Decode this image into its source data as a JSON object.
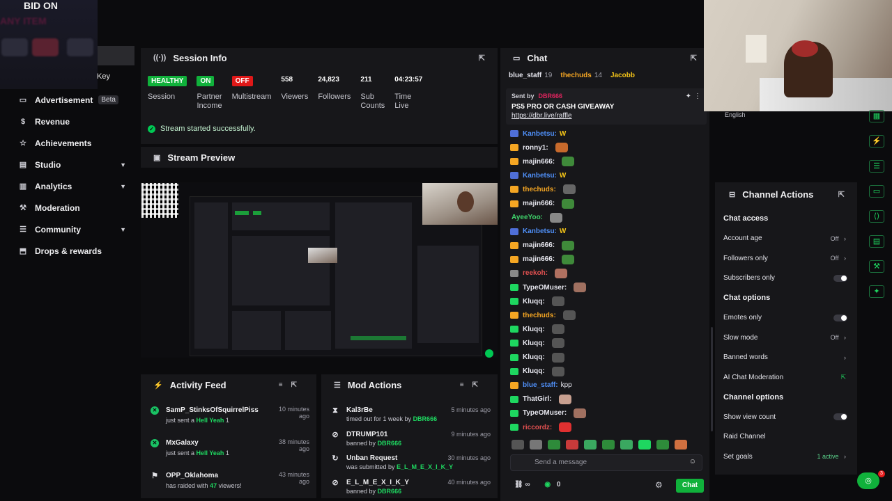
{
  "overlay": {
    "bid_on": "BID ON",
    "any_item": "ANY ITEM",
    "key_label": "Key"
  },
  "nav": {
    "items": [
      {
        "icon": "ad-icon",
        "glyph": "▭",
        "label": "Advertisement",
        "badge": "Beta",
        "chevron": false
      },
      {
        "icon": "revenue-icon",
        "glyph": "$",
        "label": "Revenue",
        "badge": "",
        "chevron": false
      },
      {
        "icon": "achievements-icon",
        "glyph": "☆",
        "label": "Achievements",
        "badge": "",
        "chevron": false
      },
      {
        "icon": "studio-icon",
        "glyph": "▤",
        "label": "Studio",
        "badge": "",
        "chevron": true
      },
      {
        "icon": "analytics-icon",
        "glyph": "▥",
        "label": "Analytics",
        "badge": "",
        "chevron": true
      },
      {
        "icon": "moderation-icon",
        "glyph": "⚒",
        "label": "Moderation",
        "badge": "",
        "chevron": false
      },
      {
        "icon": "community-icon",
        "glyph": "☰",
        "label": "Community",
        "badge": "",
        "chevron": true
      },
      {
        "icon": "drops-icon",
        "glyph": "⬒",
        "label": "Drops & rewards",
        "badge": "",
        "chevron": false
      }
    ]
  },
  "session": {
    "title": "Session Info",
    "stats": [
      {
        "value": "HEALTHY",
        "pill": "green",
        "label": "Session"
      },
      {
        "value": "ON",
        "pill": "green",
        "label": "Partner\nIncome"
      },
      {
        "value": "OFF",
        "pill": "red",
        "label": "Multistream"
      },
      {
        "value": "558",
        "pill": "",
        "label": "Viewers"
      },
      {
        "value": "24,823",
        "pill": "",
        "label": "Followers"
      },
      {
        "value": "211",
        "pill": "",
        "label": "Sub\nCounts"
      },
      {
        "value": "04:23:57",
        "pill": "",
        "label": "Time\nLive"
      }
    ],
    "status": "Stream started successfully."
  },
  "preview": {
    "title": "Stream Preview"
  },
  "activity": {
    "title": "Activity Feed",
    "items": [
      {
        "user": "SamP_StinksOfSquirrelPiss",
        "action": "just sent a",
        "item": "Hell Yeah",
        "qty": "1",
        "time": "10 minutes ago",
        "type": "gift"
      },
      {
        "user": "MxGalaxy",
        "action": "just sent a",
        "item": "Hell Yeah",
        "qty": "1",
        "time": "38 minutes ago",
        "type": "gift"
      },
      {
        "user": "OPP_Oklahoma",
        "action": "has raided with",
        "item": "47",
        "qty": "viewers!",
        "time": "43 minutes ago",
        "type": "raid"
      }
    ]
  },
  "mod": {
    "title": "Mod Actions",
    "items": [
      {
        "icon": "timeout-icon",
        "glyph": "⧗",
        "user": "Kal3rBe",
        "desc": "timed out for 1 week by",
        "by": "DBR666",
        "time": "5 minutes ago"
      },
      {
        "icon": "ban-icon",
        "glyph": "⊘",
        "user": "DTRUMP101",
        "desc": "banned by",
        "by": "DBR666",
        "time": "9 minutes ago"
      },
      {
        "icon": "unban-icon",
        "glyph": "↻",
        "user": "Unban Request",
        "desc": "was submitted by",
        "by": "E_L_M_E_X_I_K_Y",
        "time": "30 minutes ago"
      },
      {
        "icon": "ban-icon",
        "glyph": "⊘",
        "user": "E_L_M_E_X_I_K_Y",
        "desc": "banned by",
        "by": "DBR666",
        "time": "40 minutes ago"
      }
    ]
  },
  "chat": {
    "title": "Chat",
    "top": [
      {
        "name": "blue_staff",
        "count": "19",
        "color": "#e6e6ee"
      },
      {
        "name": "thechuds",
        "count": "14",
        "color": "#f5a623"
      },
      {
        "name": "Jacobb",
        "count": "",
        "color": "#f5c518"
      }
    ],
    "pinned": {
      "sent_by": "Sent by",
      "sender": "DBR666",
      "text": "PS5 PRO OR CASH GIVEAWAY",
      "link": "https://dbr.live/raffle"
    },
    "messages": [
      {
        "user": "Kanbetsu:",
        "color": "#4f8ff7",
        "text": "W",
        "b": "#4f6fd8",
        "e": ""
      },
      {
        "user": "ronny1:",
        "color": "#e6e6ee",
        "text": "",
        "b": "#f5a623",
        "e": "#c76a2c"
      },
      {
        "user": "majin666:",
        "color": "#e6e6ee",
        "text": "",
        "b": "#f5a623",
        "e": "#3f8a3a"
      },
      {
        "user": "Kanbetsu:",
        "color": "#4f8ff7",
        "text": "W",
        "b": "#4f6fd8",
        "e": ""
      },
      {
        "user": "thechuds:",
        "color": "#f5a623",
        "text": "",
        "b": "#f5a623",
        "e": "#666"
      },
      {
        "user": "majin666:",
        "color": "#e6e6ee",
        "text": "",
        "b": "#f5a623",
        "e": "#3f8a3a"
      },
      {
        "user": "AyeeYoo:",
        "color": "#3fd46b",
        "text": "",
        "b": "",
        "e": "#888"
      },
      {
        "user": "Kanbetsu:",
        "color": "#4f8ff7",
        "text": "W",
        "b": "#4f6fd8",
        "e": ""
      },
      {
        "user": "majin666:",
        "color": "#e6e6ee",
        "text": "",
        "b": "#f5a623",
        "e": "#3f8a3a"
      },
      {
        "user": "majin666:",
        "color": "#e6e6ee",
        "text": "",
        "b": "#f5a623",
        "e": "#3f8a3a"
      },
      {
        "user": "reekoh:",
        "color": "#e05050",
        "text": "",
        "b": "#888",
        "e": "#b07060"
      },
      {
        "user": "TypeOMuser:",
        "color": "#e6e6ee",
        "text": "",
        "b": "#1ed760",
        "e": "#a07060"
      },
      {
        "user": "Kluqq:",
        "color": "#e6e6ee",
        "text": "",
        "b": "#1ed760",
        "e": "#555"
      },
      {
        "user": "thechuds:",
        "color": "#f5a623",
        "text": "",
        "b": "#f5a623",
        "e": "#555"
      },
      {
        "user": "Kluqq:",
        "color": "#e6e6ee",
        "text": "",
        "b": "#1ed760",
        "e": "#555"
      },
      {
        "user": "Kluqq:",
        "color": "#e6e6ee",
        "text": "",
        "b": "#1ed760",
        "e": "#555"
      },
      {
        "user": "Kluqq:",
        "color": "#e6e6ee",
        "text": "",
        "b": "#1ed760",
        "e": "#555"
      },
      {
        "user": "Kluqq:",
        "color": "#e6e6ee",
        "text": "",
        "b": "#1ed760",
        "e": "#555"
      },
      {
        "user": "blue_staff:",
        "color": "#4f8ff7",
        "text": "kpp",
        "b": "#f5a623",
        "e": ""
      },
      {
        "user": "ThatGirl:",
        "color": "#e6e6ee",
        "text": "",
        "b": "#1ed760",
        "e": "#c8a090"
      },
      {
        "user": "TypeOMuser:",
        "color": "#e6e6ee",
        "text": "",
        "b": "#1ed760",
        "e": "#a07060"
      },
      {
        "user": "riccordz:",
        "color": "#e05050",
        "text": "",
        "b": "#1ed760",
        "e": "#e03030"
      }
    ],
    "placeholder": "Send a message",
    "footer": "∞",
    "points": "0",
    "chat_button": "Chat"
  },
  "channel": {
    "title": "Channel Actions",
    "language": "English",
    "rows": [
      {
        "label": "Chat access",
        "sec": true,
        "right": "",
        "kind": ""
      },
      {
        "label": "Account age",
        "sec": false,
        "right": "Off",
        "kind": "chev"
      },
      {
        "label": "Followers only",
        "sec": false,
        "right": "Off",
        "kind": "chev"
      },
      {
        "label": "Subscribers only",
        "sec": false,
        "right": "",
        "kind": "toggle"
      },
      {
        "label": "Chat options",
        "sec": true,
        "right": "",
        "kind": ""
      },
      {
        "label": "Emotes only",
        "sec": false,
        "right": "",
        "kind": "toggle"
      },
      {
        "label": "Slow mode",
        "sec": false,
        "right": "Off",
        "kind": "chev"
      },
      {
        "label": "Banned words",
        "sec": false,
        "right": "",
        "kind": "chev"
      },
      {
        "label": "AI Chat Moderation",
        "sec": false,
        "right": "",
        "kind": "ext"
      },
      {
        "label": "Channel options",
        "sec": true,
        "right": "",
        "kind": ""
      },
      {
        "label": "Show view count",
        "sec": false,
        "right": "",
        "kind": "toggle"
      },
      {
        "label": "Raid Channel",
        "sec": false,
        "right": "",
        "kind": ""
      },
      {
        "label": "Set goals",
        "sec": false,
        "right": "1 active",
        "kind": "goals"
      }
    ]
  },
  "rail": [
    "grid-icon",
    "bolt-icon",
    "list-icon",
    "chat-icon",
    "code-icon",
    "layout-icon",
    "wrench-icon",
    "puzzle-icon"
  ],
  "help_count": "3"
}
